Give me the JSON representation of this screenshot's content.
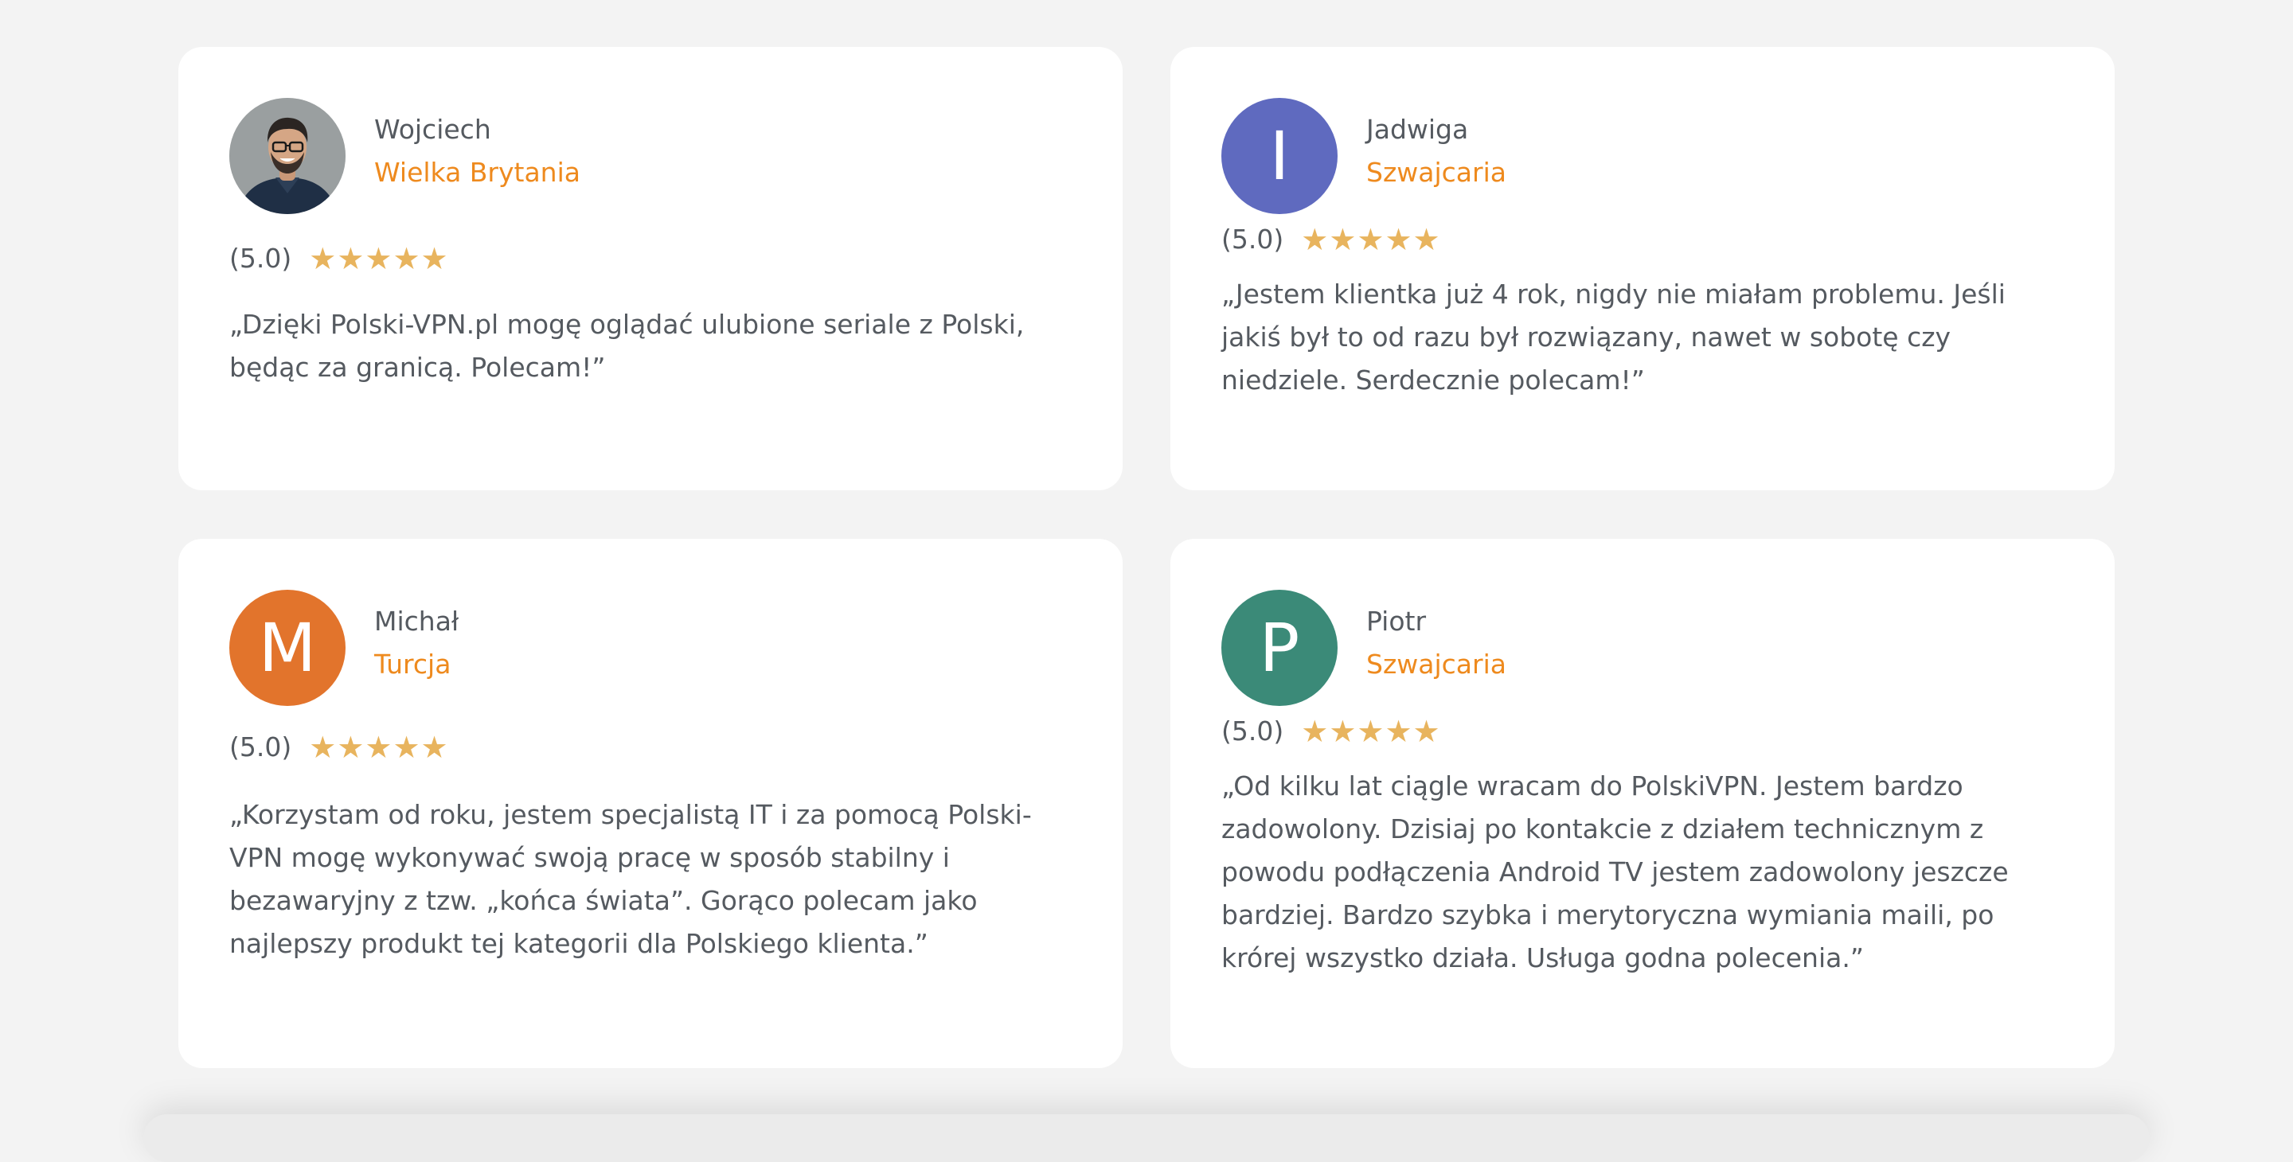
{
  "rating_star_color": "#e8b45e",
  "accent_color": "#ee8a1e",
  "text_color": "#555a60",
  "reviews": [
    {
      "name": "Wojciech",
      "country": "Wielka Brytania",
      "rating": "(5.0)",
      "stars": 5,
      "avatar": {
        "type": "photo",
        "icon": "user-photo-avatar"
      },
      "text": "„Dzięki Polski-VPN.pl mogę oglądać ulubione seriale z Polski, będąc za granicą. Polecam!”"
    },
    {
      "name": "Jadwiga",
      "country": "Szwajcaria",
      "rating": "(5.0)",
      "stars": 5,
      "avatar": {
        "type": "initial",
        "initial": "I",
        "color": "#5f6abf"
      },
      "text": "„Jestem klientka już 4 rok, nigdy nie miałam problemu. Jeśli jakiś był to od razu był rozwiązany, nawet w sobotę czy niedziele. Serdecznie polecam!”"
    },
    {
      "name": "Michał",
      "country": "Turcja",
      "rating": "(5.0)",
      "stars": 5,
      "avatar": {
        "type": "initial",
        "initial": "M",
        "color": "#e2742c"
      },
      "text": "„Korzystam od roku, jestem specjalistą IT i za pomocą Polski-VPN mogę wykonywać swoją pracę w sposób stabilny i bezawaryjny z tzw. „końca świata”. Gorąco polecam jako najlepszy produkt tej kategorii dla Polskiego klienta.”"
    },
    {
      "name": "Piotr",
      "country": "Szwajcaria",
      "rating": "(5.0)",
      "stars": 5,
      "avatar": {
        "type": "initial",
        "initial": "P",
        "color": "#3b8a78"
      },
      "text": "„Od kilku lat ciągle wracam do PolskiVPN. Jestem bardzo zadowolony. Dzisiaj po kontakcie z działem technicznym z powodu podłączenia Android TV jestem zadowolony jeszcze bardziej. Bardzo szybka i merytoryczna wymiania maili, po krórej wszystko działa. Usługa godna polecenia.”"
    }
  ]
}
